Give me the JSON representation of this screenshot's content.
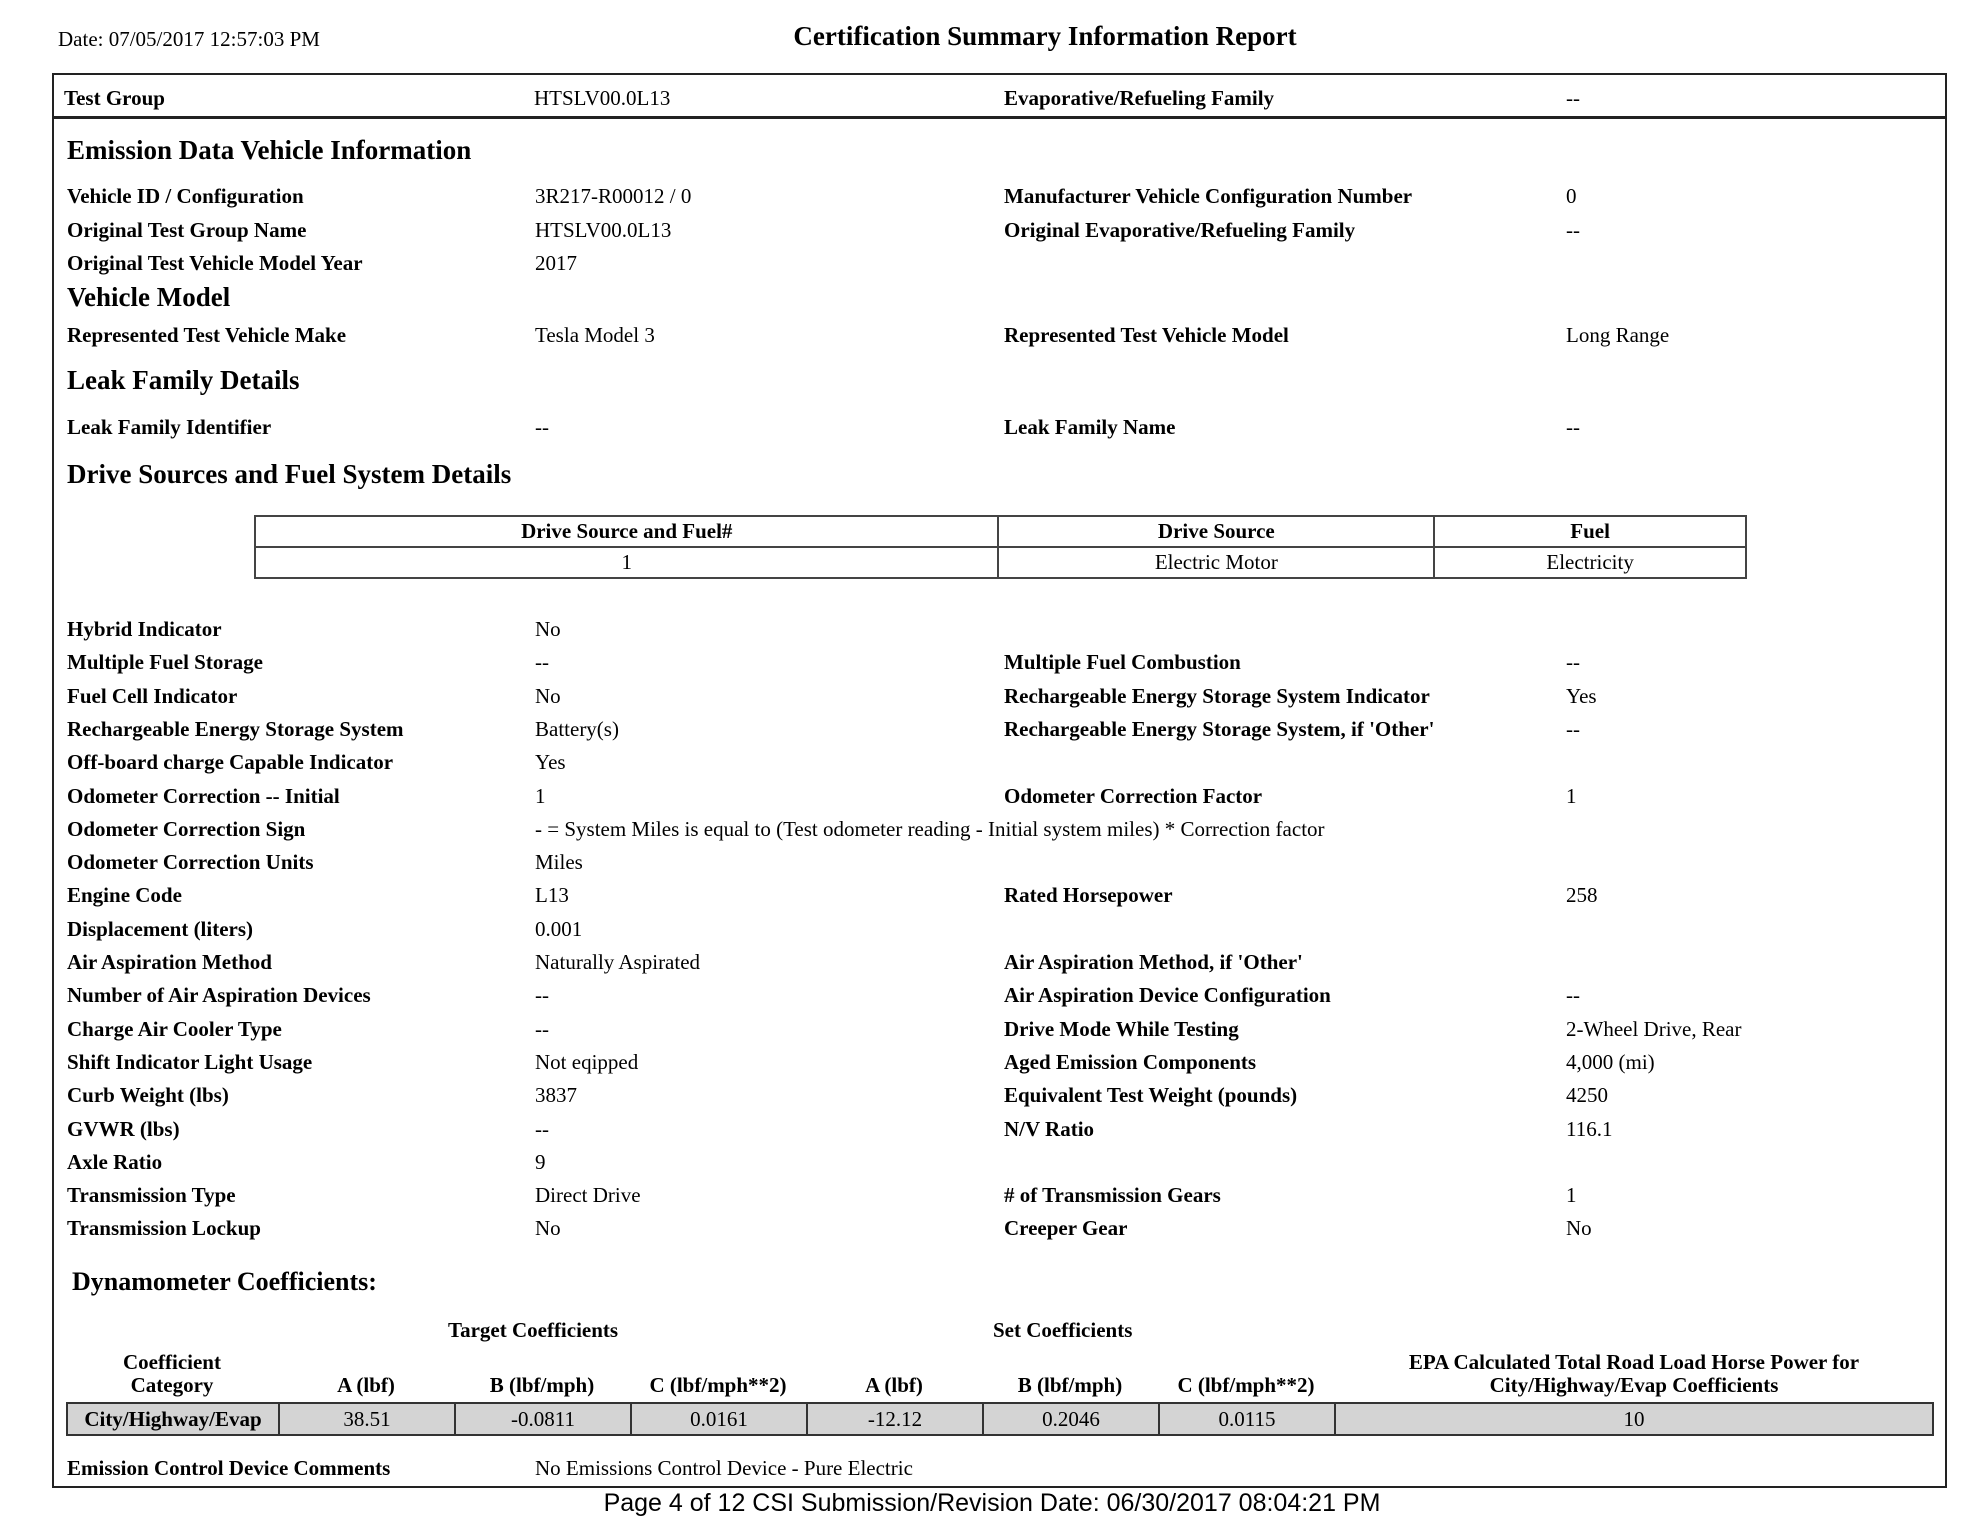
{
  "header": {
    "date": "Date: 07/05/2017 12:57:03 PM",
    "title": "Certification Summary Information Report"
  },
  "top_row": {
    "test_group_label": "Test Group",
    "test_group_value": "HTSLV00.0L13",
    "evap_family_label": "Evaporative/Refueling Family",
    "evap_family_value": "--"
  },
  "sections": {
    "edv_info": "Emission Data Vehicle Information",
    "vehicle_model": "Vehicle Model",
    "leak_family": "Leak Family Details",
    "drive_sources": "Drive Sources and Fuel System Details",
    "dyno": "Dynamometer Coefficients:"
  },
  "edv": {
    "left": [
      {
        "label": "Vehicle ID / Configuration",
        "value": "3R217-R00012 / 0"
      },
      {
        "label": "Original Test Group Name",
        "value": "HTSLV00.0L13"
      },
      {
        "label": "Original Test Vehicle Model Year",
        "value": "2017"
      }
    ],
    "right": [
      {
        "label": "Manufacturer Vehicle Configuration Number",
        "value": "0"
      },
      {
        "label": "Original Evaporative/Refueling Family",
        "value": "--"
      }
    ]
  },
  "vehicle_model": {
    "make_label": "Represented Test Vehicle Make",
    "make_value": "Tesla Model 3",
    "model_label": "Represented Test Vehicle Model",
    "model_value": "Long Range"
  },
  "leak": {
    "id_label": "Leak Family Identifier",
    "id_value": "--",
    "name_label": "Leak Family Name",
    "name_value": "--"
  },
  "drive_table": {
    "headers": [
      "Drive Source and Fuel#",
      "Drive Source",
      "Fuel"
    ],
    "rows": [
      [
        "1",
        "Electric Motor",
        "Electricity"
      ]
    ]
  },
  "details": {
    "left": [
      {
        "label": "Hybrid Indicator",
        "value": "No"
      },
      {
        "label": "Multiple Fuel Storage",
        "value": "--"
      },
      {
        "label": "Fuel Cell Indicator",
        "value": "No"
      },
      {
        "label": "Rechargeable Energy Storage System",
        "value": "Battery(s)"
      },
      {
        "label": "Off-board charge Capable Indicator",
        "value": "Yes"
      },
      {
        "label": "Odometer Correction -- Initial",
        "value": "1"
      },
      {
        "label": "Odometer Correction Sign",
        "value": "- = System Miles is equal to (Test odometer reading - Initial system miles) * Correction factor"
      },
      {
        "label": "Odometer Correction Units",
        "value": "Miles"
      },
      {
        "label": "Engine Code",
        "value": "L13"
      },
      {
        "label": "Displacement (liters)",
        "value": "0.001"
      },
      {
        "label": "Air Aspiration Method",
        "value": "Naturally Aspirated"
      },
      {
        "label": "Number of Air Aspiration Devices",
        "value": "--"
      },
      {
        "label": "Charge Air Cooler Type",
        "value": "--"
      },
      {
        "label": "Shift Indicator Light Usage",
        "value": "Not eqipped"
      },
      {
        "label": "Curb Weight (lbs)",
        "value": "3837"
      },
      {
        "label": "GVWR (lbs)",
        "value": "--"
      },
      {
        "label": "Axle Ratio",
        "value": "9"
      },
      {
        "label": "Transmission Type",
        "value": "Direct Drive"
      },
      {
        "label": "Transmission Lockup",
        "value": "No"
      }
    ],
    "right": [
      {
        "row": 1,
        "label": "Multiple Fuel Combustion",
        "value": "--"
      },
      {
        "row": 2,
        "label": "Rechargeable Energy Storage System Indicator",
        "value": "Yes"
      },
      {
        "row": 3,
        "label": "Rechargeable Energy Storage System, if 'Other'",
        "value": "--"
      },
      {
        "row": 5,
        "label": "Odometer Correction Factor",
        "value": "1"
      },
      {
        "row": 8,
        "label": "Rated Horsepower",
        "value": "258"
      },
      {
        "row": 10,
        "label": "Air Aspiration Method, if 'Other'",
        "value": ""
      },
      {
        "row": 11,
        "label": "Air Aspiration Device Configuration",
        "value": "--"
      },
      {
        "row": 12,
        "label": "Drive Mode While Testing",
        "value": "2-Wheel Drive, Rear"
      },
      {
        "row": 13,
        "label": "Aged Emission Components",
        "value": "4,000 (mi)"
      },
      {
        "row": 14,
        "label": "Equivalent Test Weight (pounds)",
        "value": "4250"
      },
      {
        "row": 15,
        "label": "N/V Ratio",
        "value": "116.1"
      },
      {
        "row": 17,
        "label": "# of Transmission Gears",
        "value": "1"
      },
      {
        "row": 18,
        "label": "Creeper Gear",
        "value": "No"
      }
    ]
  },
  "dyno": {
    "target_label": "Target Coefficients",
    "set_label": "Set Coefficients",
    "col_category": [
      "Coefficient",
      "Category"
    ],
    "col_a": "A (lbf)",
    "col_b": "B (lbf/mph)",
    "col_c": "C (lbf/mph**2)",
    "col_epa": [
      "EPA Calculated Total Road Load Horse Power for",
      "City/Highway/Evap Coefficients"
    ],
    "row": {
      "category": "City/Highway/Evap",
      "target_a": "38.51",
      "target_b": "-0.0811",
      "target_c": "0.0161",
      "set_a": "-12.12",
      "set_b": "0.2046",
      "set_c": "0.0115",
      "epa_hp": "10"
    }
  },
  "comments": {
    "label": "Emission Control Device Comments",
    "value": "No Emissions Control Device - Pure Electric"
  },
  "footer": "Page 4 of 12   CSI Submission/Revision Date: 06/30/2017 08:04:21 PM"
}
